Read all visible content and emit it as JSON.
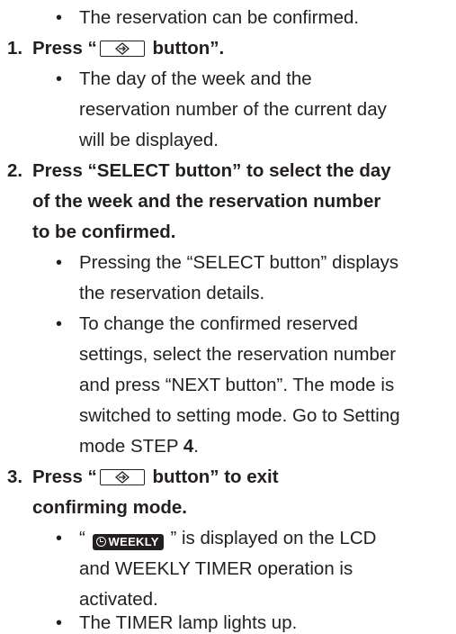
{
  "intro_bullet": "The reservation can be confirmed.",
  "bullet_char": "•",
  "icons": {
    "button_icon": "set-arrow-button-icon",
    "badge_icon": "clock-icon"
  },
  "steps": [
    {
      "number": "1.",
      "heading_pre": "Press “",
      "heading_post": " button”.",
      "bullets": [
        [
          "The day of the week and the",
          "reservation number of the current day",
          "will be displayed."
        ]
      ]
    },
    {
      "number": "2.",
      "heading_lines": [
        "Press “SELECT button” to select the day",
        "of the week and the reservation number",
        "to be confirmed."
      ],
      "bullets": [
        [
          "Pressing the “SELECT button” displays",
          "the reservation details."
        ],
        [
          "To change the confirmed reserved",
          "settings, select the reservation number",
          "and press “NEXT button”. The mode is",
          "switched to setting mode. Go to Setting"
        ],
        {
          "pre": "mode STEP ",
          "bold": "4",
          "post": "."
        }
      ]
    },
    {
      "number": "3.",
      "heading_pre": "Press “",
      "heading_post": " button” to exit",
      "heading_line2": "confirming mode.",
      "bullets": [
        {
          "pre": "“ ",
          "badge": "WEEKLY",
          "post": " ” is displayed on the LCD"
        },
        [
          "and WEEKLY TIMER operation is",
          "activated."
        ],
        [
          "The TIMER lamp lights up."
        ]
      ]
    }
  ]
}
